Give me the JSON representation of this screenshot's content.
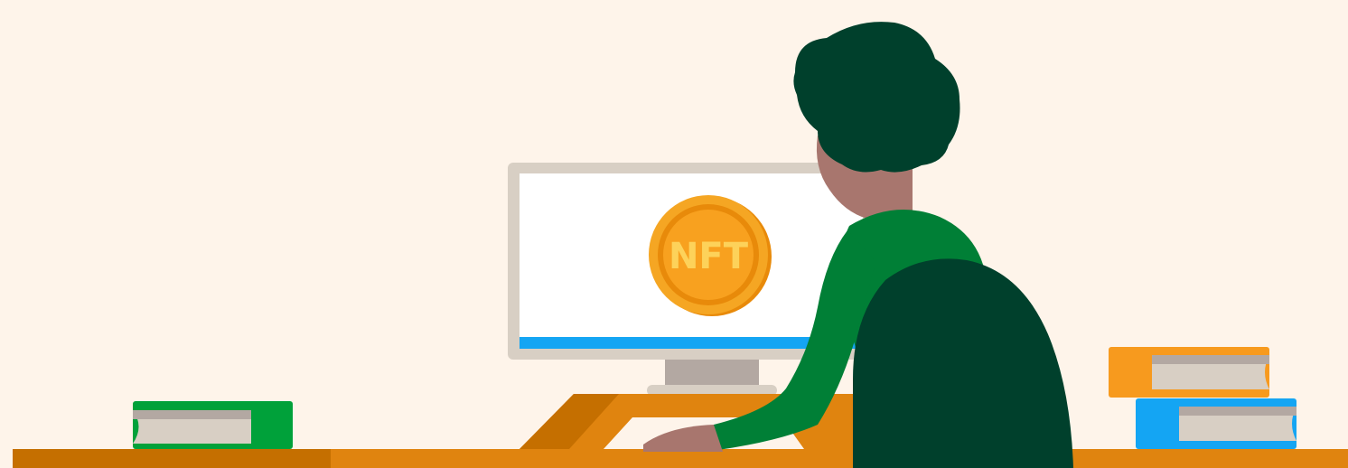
{
  "colors": {
    "background": "#fef4ea",
    "desk": "#e0840f",
    "desk_shadow": "#c56f00",
    "monitor_frame": "#d8cfc4",
    "monitor_screen": "#ffffff",
    "progress_bar": "#14a5f3",
    "stand": "#b3a8a2",
    "coin": "#f5a623",
    "coin_inner": "#f8a11f",
    "coin_ring": "#e88a0a",
    "coin_text": "#fdd25a",
    "hair": "#00402c",
    "skin": "#a8766e",
    "sweater": "#007f36",
    "chair": "#00402c",
    "book_green": "#00a13a",
    "book_orange": "#f79a1e",
    "book_blue": "#14a5f3",
    "pages": "#d8cfc4"
  },
  "coin": {
    "label": "NFT",
    "icon": "nft-coin-icon"
  }
}
